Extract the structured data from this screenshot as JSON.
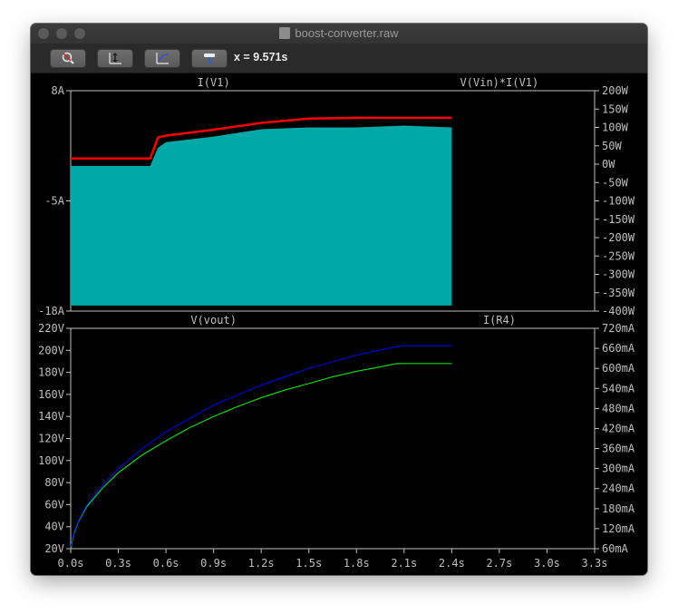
{
  "window": {
    "title": "boost-converter.raw"
  },
  "toolbar": {
    "buttons": [
      {
        "icon": "zoom-icon"
      },
      {
        "icon": "autorange-icon"
      },
      {
        "icon": "pan-icon"
      },
      {
        "icon": "hammer-icon"
      }
    ],
    "cursor_readout": "x = 9.571s"
  },
  "colors": {
    "background": "#000000",
    "axis": "#c0c0c0",
    "i_v1": "#ff0000",
    "power": "#00a8a8",
    "vout": "#00ff00",
    "i_r4": "#0000ff"
  },
  "chart_data": [
    {
      "type": "line",
      "series": [
        {
          "name": "I(V1)",
          "color": "#ff0000",
          "axis": "left",
          "x": [
            0.0,
            0.3,
            0.5,
            0.55,
            0.6,
            0.9,
            1.2,
            1.5,
            1.8,
            2.1,
            2.4
          ],
          "y": [
            0.0,
            0.0,
            0.0,
            2.5,
            2.7,
            3.4,
            4.2,
            4.7,
            4.8,
            4.8,
            4.8
          ]
        },
        {
          "name": "V(Vin)*I(V1)",
          "color": "#00a8a8",
          "axis": "right",
          "x": [
            0.0,
            0.3,
            0.5,
            0.55,
            0.6,
            0.9,
            1.2,
            1.5,
            1.8,
            2.1,
            2.4
          ],
          "y_top": [
            -5,
            -5,
            -5,
            45,
            60,
            75,
            95,
            100,
            100,
            105,
            100
          ],
          "y_bottom": -385
        }
      ],
      "x_ticks": [
        "0.0s",
        "0.3s",
        "0.6s",
        "0.9s",
        "1.2s",
        "1.5s",
        "1.8s",
        "2.1s",
        "2.4s",
        "2.7s",
        "3.0s",
        "3.3s"
      ],
      "y_left": {
        "ticks": [
          "8A",
          "-5A",
          "-18A"
        ],
        "values": [
          8,
          -5,
          -18
        ],
        "range": [
          -18,
          8
        ]
      },
      "y_right": {
        "ticks": [
          "200W",
          "150W",
          "100W",
          "50W",
          "0W",
          "-50W",
          "-100W",
          "-150W",
          "-200W",
          "-250W",
          "-300W",
          "-350W",
          "-400W"
        ],
        "values": [
          200,
          150,
          100,
          50,
          0,
          -50,
          -100,
          -150,
          -200,
          -250,
          -300,
          -350,
          -400
        ],
        "range": [
          -400,
          200
        ]
      },
      "xlim": [
        0,
        3.3
      ]
    },
    {
      "type": "line",
      "series": [
        {
          "name": "V(vout)",
          "color": "#00ff00",
          "axis": "left",
          "x": [
            0.0,
            0.02,
            0.05,
            0.1,
            0.2,
            0.3,
            0.45,
            0.6,
            0.75,
            0.9,
            1.05,
            1.2,
            1.35,
            1.5,
            1.65,
            1.8,
            1.95,
            2.05,
            2.1,
            2.4
          ],
          "y": [
            20,
            34,
            45,
            58,
            75,
            89,
            105,
            118,
            130,
            140,
            149,
            157,
            164,
            170,
            176,
            181,
            185,
            188,
            188,
            188
          ]
        },
        {
          "name": "I(R4)",
          "color": "#0000ff",
          "axis": "right",
          "x": [
            0.0,
            0.02,
            0.05,
            0.1,
            0.2,
            0.3,
            0.45,
            0.6,
            0.75,
            0.9,
            1.05,
            1.2,
            1.35,
            1.5,
            1.65,
            1.8,
            1.95,
            2.05,
            2.1,
            2.4
          ],
          "y": [
            66,
            110,
            145,
            190,
            250,
            300,
            360,
            410,
            450,
            490,
            520,
            550,
            575,
            600,
            620,
            640,
            655,
            665,
            668,
            668
          ]
        }
      ],
      "x_ticks": [
        "0.0s",
        "0.3s",
        "0.6s",
        "0.9s",
        "1.2s",
        "1.5s",
        "1.8s",
        "2.1s",
        "2.4s",
        "2.7s",
        "3.0s",
        "3.3s"
      ],
      "y_left": {
        "ticks": [
          "220V",
          "200V",
          "180V",
          "160V",
          "140V",
          "120V",
          "100V",
          "80V",
          "60V",
          "40V",
          "20V"
        ],
        "values": [
          220,
          200,
          180,
          160,
          140,
          120,
          100,
          80,
          60,
          40,
          20
        ],
        "range": [
          20,
          220
        ]
      },
      "y_right": {
        "ticks": [
          "720mA",
          "660mA",
          "600mA",
          "540mA",
          "480mA",
          "420mA",
          "360mA",
          "300mA",
          "240mA",
          "180mA",
          "120mA",
          "60mA"
        ],
        "values": [
          720,
          660,
          600,
          540,
          480,
          420,
          360,
          300,
          240,
          180,
          120,
          60
        ],
        "range": [
          60,
          720
        ]
      },
      "xlim": [
        0,
        3.3
      ]
    }
  ]
}
